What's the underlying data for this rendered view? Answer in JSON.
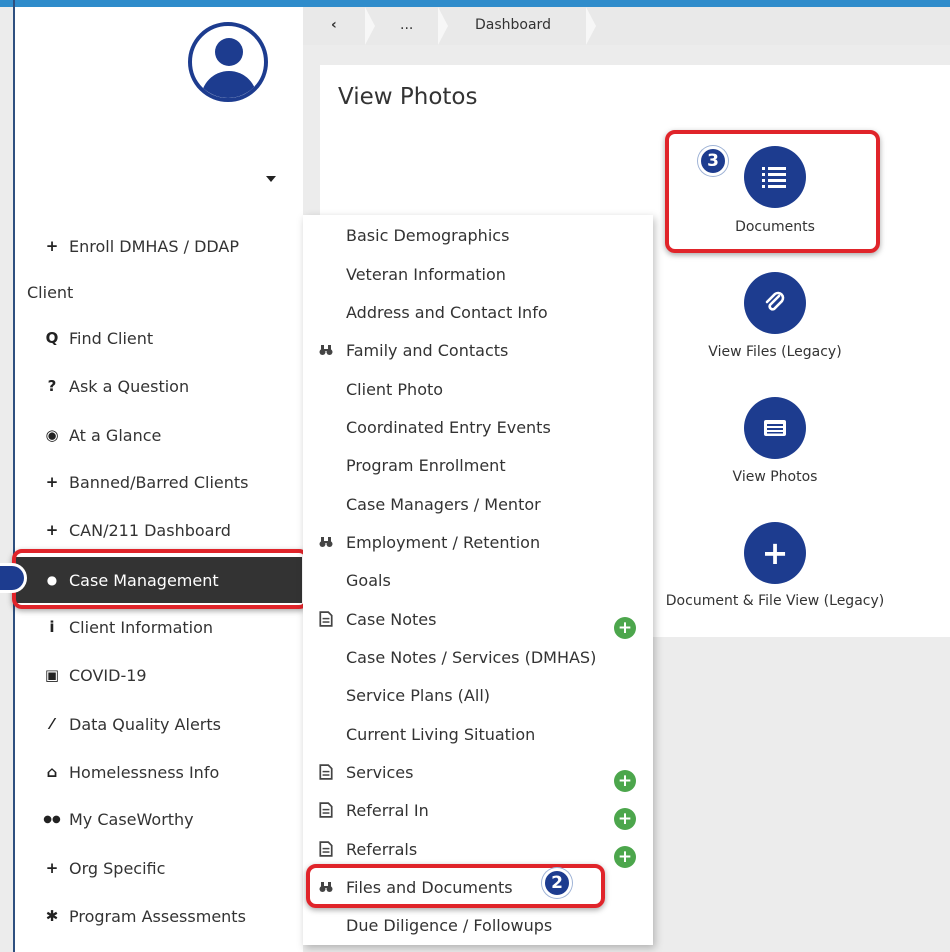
{
  "breadcrumb": {
    "back": "‹",
    "ellipsis": "...",
    "current": "Dashboard"
  },
  "page": {
    "title": "View Photos"
  },
  "sidebar": {
    "section_label": "Client",
    "items": [
      {
        "icon": "+",
        "label": "Enroll DMHAS / DDAP"
      },
      {
        "icon": "Q",
        "label": "Find Client"
      },
      {
        "icon": "?",
        "label": "Ask a Question"
      },
      {
        "icon": "◉",
        "label": "At a Glance"
      },
      {
        "icon": "+",
        "label": "Banned/Barred Clients"
      },
      {
        "icon": "+",
        "label": "CAN/211 Dashboard"
      },
      {
        "icon": "●",
        "label": "Case Management"
      },
      {
        "icon": "i",
        "label": "Client Information"
      },
      {
        "icon": "▣",
        "label": "COVID-19"
      },
      {
        "icon": "⁄",
        "label": "Data Quality Alerts"
      },
      {
        "icon": "⌂",
        "label": "Homelessness Info"
      },
      {
        "icon": "●●",
        "label": "My CaseWorthy"
      },
      {
        "icon": "+",
        "label": "Org Specific"
      },
      {
        "icon": "✱",
        "label": "Program Assessments"
      }
    ]
  },
  "menu": {
    "items": [
      {
        "label": "Basic Demographics",
        "icon": ""
      },
      {
        "label": "Veteran Information",
        "icon": ""
      },
      {
        "label": "Address and Contact Info",
        "icon": ""
      },
      {
        "label": "Family and Contacts",
        "icon": "binoculars-icon"
      },
      {
        "label": "Client Photo",
        "icon": ""
      },
      {
        "label": "Coordinated Entry Events",
        "icon": ""
      },
      {
        "label": "Program Enrollment",
        "icon": ""
      },
      {
        "label": "Case Managers / Mentor",
        "icon": ""
      },
      {
        "label": "Employment / Retention",
        "icon": "binoculars-icon"
      },
      {
        "label": "Goals",
        "icon": ""
      },
      {
        "label": "Case Notes",
        "icon": "document-icon"
      },
      {
        "label": "Case Notes / Services (DMHAS)",
        "icon": ""
      },
      {
        "label": "Service Plans (All)",
        "icon": ""
      },
      {
        "label": "Current Living Situation",
        "icon": ""
      },
      {
        "label": "Services",
        "icon": "document-icon"
      },
      {
        "label": "Referral In",
        "icon": "document-icon"
      },
      {
        "label": "Referrals",
        "icon": "document-icon"
      },
      {
        "label": "Files and Documents",
        "icon": "binoculars-icon"
      },
      {
        "label": "Due Diligence / Followups",
        "icon": ""
      }
    ]
  },
  "tiles": [
    {
      "label": "Documents",
      "icon": "list-icon"
    },
    {
      "label": "View Files (Legacy)",
      "icon": "paperclip-icon"
    },
    {
      "label": "View Photos",
      "icon": "image-icon"
    },
    {
      "label": "Document & File View (Legacy)",
      "icon": "plus-icon"
    }
  ],
  "badges": {
    "step2": "2",
    "step3": "3"
  },
  "plus_symbol": "+",
  "colors": {
    "brand": "#1d3c8f",
    "highlight": "#e0242a",
    "active_nav": "#333333",
    "add_green": "#4ca64c",
    "top_bar": "#2f8ccb"
  }
}
